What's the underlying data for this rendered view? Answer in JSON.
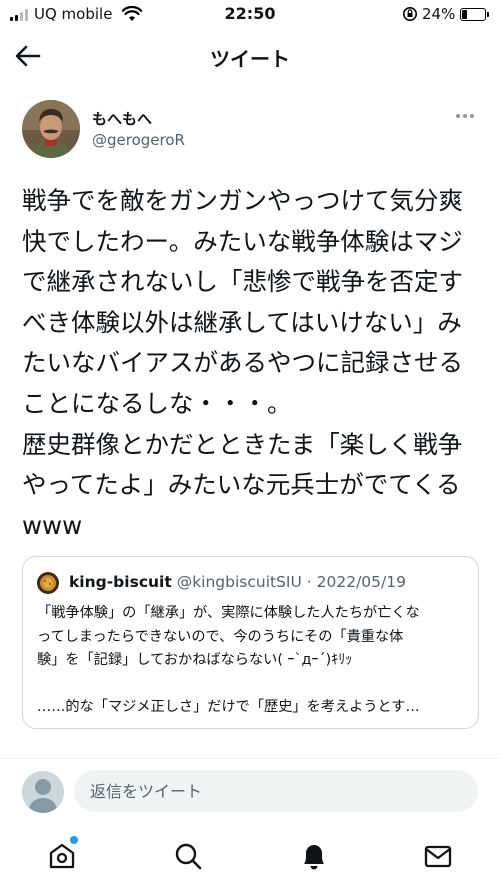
{
  "status_bar": {
    "carrier": "UQ mobile",
    "time": "22:50",
    "battery_percent": "24%",
    "battery_level": 0.24
  },
  "header": {
    "title": "ツイート"
  },
  "tweet": {
    "display_name": "もへもへ",
    "handle": "@gerogeroR",
    "text": "戦争でを敵をガンガンやっつけて気分爽\n快でしたわー。みたいな戦争体験はマジ\nで継承されないし「悲惨で戦争を否定す\nべき体験以外は継承してはいけない」み\nたいなバイアスがあるやつに記録させる\nことになるしな・・・。\n歴史群像とかだとときたま「楽しく戦争\nやってたよ」みたいな元兵士がでてくる\nwww"
  },
  "quoted_tweet": {
    "display_name": "king-biscuit",
    "handle_date": "@kingbiscuitSIU · 2022/05/19",
    "text": "「戦争体験」の「継承」が、実際に体験した人たちが亡くな\nってしまったらできないので、今のうちにその「貴重な体\n験」を「記録」しておかねばならない( ｰ`дｰ´)ｷﾘｯ\n\n……的な「マジメ正しさ」だけで「歴史」を考えようとす…"
  },
  "reply": {
    "placeholder": "返信をツイート"
  },
  "nav": {
    "items": [
      "home-icon",
      "search-icon",
      "notifications-icon",
      "messages-icon"
    ],
    "accent": "#1d9bf0"
  }
}
